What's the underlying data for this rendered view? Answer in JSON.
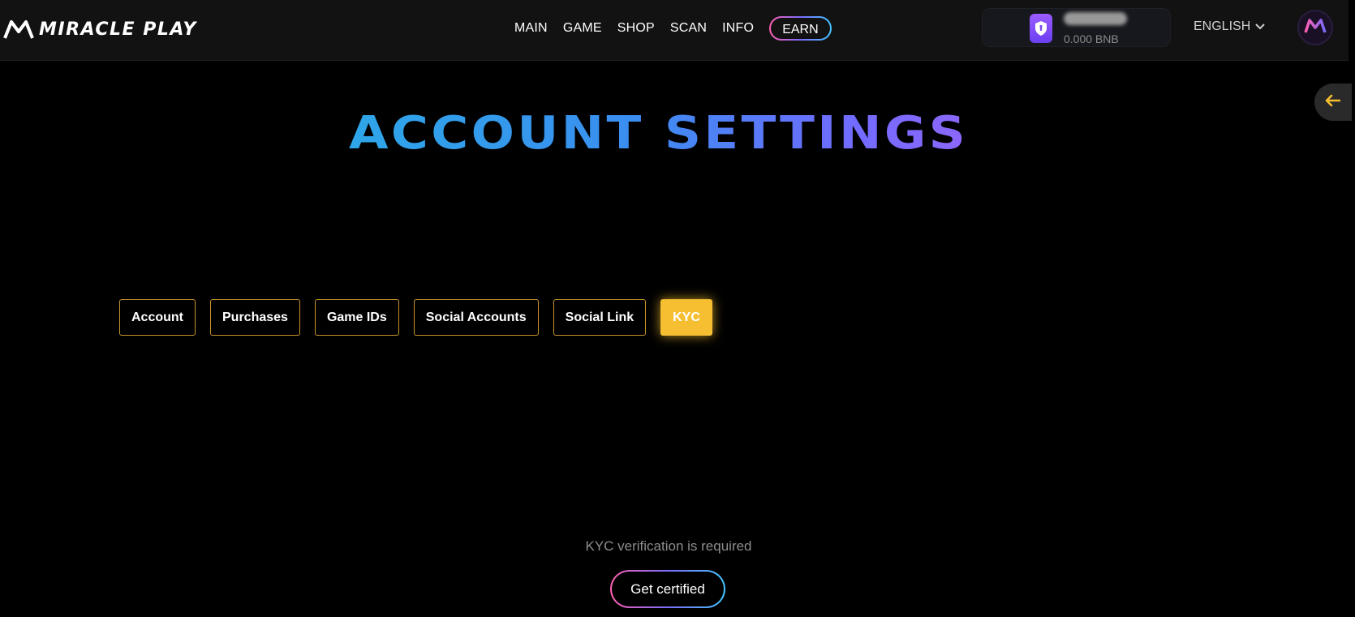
{
  "header": {
    "logo_text": "MIRACLE PLAY",
    "nav": [
      {
        "label": "MAIN"
      },
      {
        "label": "GAME"
      },
      {
        "label": "SHOP"
      },
      {
        "label": "SCAN"
      },
      {
        "label": "INFO"
      }
    ],
    "earn_label": "EARN",
    "wallet": {
      "balance": "0.000 BNB"
    },
    "language": "ENGLISH"
  },
  "page": {
    "title": "ACCOUNT SETTINGS"
  },
  "tabs": [
    {
      "label": "Account",
      "active": false
    },
    {
      "label": "Purchases",
      "active": false
    },
    {
      "label": "Game IDs",
      "active": false
    },
    {
      "label": "Social Accounts",
      "active": false
    },
    {
      "label": "Social Link",
      "active": false
    },
    {
      "label": "KYC",
      "active": true
    }
  ],
  "kyc": {
    "message": "KYC verification is required",
    "button_label": "Get certified"
  },
  "colors": {
    "accent_gold": "#f6bf32",
    "tab_border": "#c9952a",
    "title_gradient_start": "#2ea6e8",
    "title_gradient_end": "#a163f5",
    "wallet_shield": "#7b4cf5"
  },
  "icons": {
    "logo": "miracle-play-logo-icon",
    "wallet": "shield-icon",
    "language": "chevron-down-icon",
    "avatar": "miracle-play-avatar-icon",
    "back": "arrow-left-icon"
  }
}
